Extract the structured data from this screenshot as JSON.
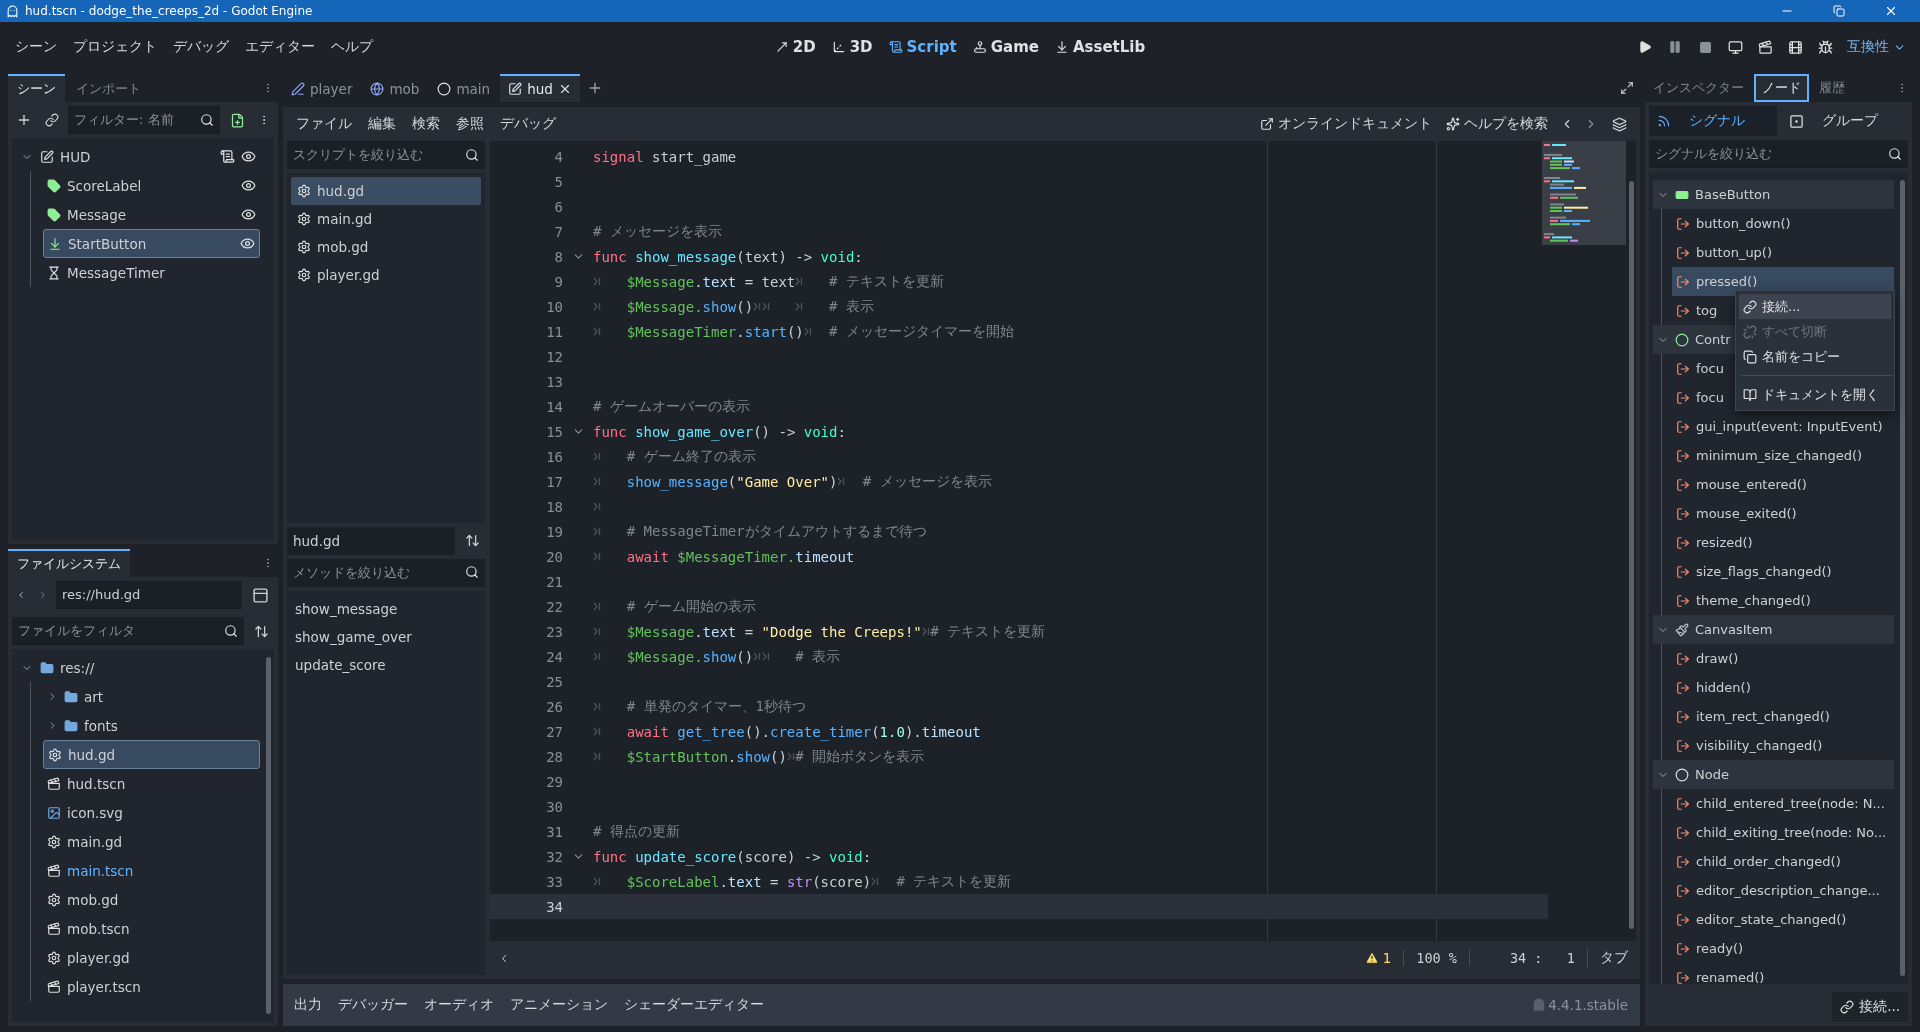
{
  "window": {
    "title": "hud.tscn - dodge_the_creeps_2d - Godot Engine"
  },
  "menu_bar": {
    "menus": [
      "シーン",
      "プロジェクト",
      "デバッグ",
      "エディター",
      "ヘルプ"
    ],
    "workspaces": [
      {
        "label": "2D",
        "kind": "flat",
        "selected": false
      },
      {
        "label": "3D",
        "kind": "spatial",
        "selected": false
      },
      {
        "label": "Script",
        "kind": "script",
        "selected": true
      },
      {
        "label": "Game",
        "kind": "game",
        "selected": false
      },
      {
        "label": "AssetLib",
        "kind": "assetlib",
        "selected": false
      }
    ],
    "renderer": "互換性"
  },
  "scene_dock": {
    "tabs": [
      {
        "label": "シーン",
        "selected": true
      },
      {
        "label": "インポート",
        "selected": false
      }
    ],
    "filter_placeholder": "フィルター: 名前",
    "tree": {
      "name": "HUD",
      "kind": "canvas_layer",
      "expanded": true,
      "script": true,
      "visible_toggle": true,
      "selected": false,
      "children": [
        {
          "name": "ScoreLabel",
          "kind": "label",
          "script": false,
          "visible_toggle": true,
          "selected": false
        },
        {
          "name": "Message",
          "kind": "label",
          "script": false,
          "visible_toggle": true,
          "selected": false
        },
        {
          "name": "StartButton",
          "kind": "button",
          "script": false,
          "visible_toggle": true,
          "selected": true
        },
        {
          "name": "MessageTimer",
          "kind": "timer",
          "script": false,
          "visible_toggle": false,
          "selected": false
        }
      ]
    }
  },
  "filesystem": {
    "tabs": [
      {
        "label": "ファイルシステム",
        "selected": true
      }
    ],
    "path": "res://hud.gd",
    "filter_placeholder": "ファイルをフィルタ",
    "tree": {
      "name": "res://",
      "kind": "folder",
      "expanded": true,
      "children": [
        {
          "name": "art",
          "kind": "folder",
          "expanded": false,
          "selected": false,
          "main_scene": false
        },
        {
          "name": "fonts",
          "kind": "folder",
          "expanded": false,
          "selected": false,
          "main_scene": false
        },
        {
          "name": "hud.gd",
          "kind": "script",
          "selected": true,
          "main_scene": false
        },
        {
          "name": "hud.tscn",
          "kind": "scene",
          "selected": false,
          "main_scene": false
        },
        {
          "name": "icon.svg",
          "kind": "image",
          "selected": false,
          "main_scene": false
        },
        {
          "name": "main.gd",
          "kind": "script",
          "selected": false,
          "main_scene": false
        },
        {
          "name": "main.tscn",
          "kind": "scene",
          "selected": false,
          "main_scene": true
        },
        {
          "name": "mob.gd",
          "kind": "script",
          "selected": false,
          "main_scene": false
        },
        {
          "name": "mob.tscn",
          "kind": "scene",
          "selected": false,
          "main_scene": false
        },
        {
          "name": "player.gd",
          "kind": "script",
          "selected": false,
          "main_scene": false
        },
        {
          "name": "player.tscn",
          "kind": "scene",
          "selected": false,
          "main_scene": false
        }
      ]
    }
  },
  "script_editor": {
    "tabs": [
      {
        "label": "player",
        "kind": "node2d",
        "selected": false
      },
      {
        "label": "mob",
        "kind": "rigid_body",
        "selected": false
      },
      {
        "label": "main",
        "kind": "node",
        "selected": false
      },
      {
        "label": "hud",
        "kind": "canvas_layer",
        "selected": true
      }
    ],
    "menus": [
      "ファイル",
      "編集",
      "検索",
      "参照",
      "デバッグ"
    ],
    "links": [
      {
        "label": "オンラインドキュメント",
        "kind": "external"
      },
      {
        "label": "ヘルプを検索",
        "kind": "help"
      }
    ],
    "script_filter_placeholder": "スクリプトを絞り込む",
    "scripts": [
      {
        "name": "hud.gd",
        "selected": true
      },
      {
        "name": "main.gd",
        "selected": false
      },
      {
        "name": "mob.gd",
        "selected": false
      },
      {
        "name": "player.gd",
        "selected": false
      }
    ],
    "current_script": "hud.gd",
    "method_filter_placeholder": "メソッドを絞り込む",
    "methods": [
      "show_message",
      "show_game_over",
      "update_score"
    ],
    "code": [
      {
        "number": "4",
        "fold": false,
        "current": false,
        "tokens": [
          {
            "kind": "keyword",
            "text": "signal"
          },
          {
            "kind": "text",
            "text": " start_game"
          }
        ]
      },
      {
        "number": "5",
        "fold": false,
        "current": false
      },
      {
        "number": "6",
        "fold": false,
        "current": false
      },
      {
        "number": "7",
        "fold": false,
        "current": false,
        "tokens": [
          {
            "kind": "comment",
            "text": "# メッセージを表示"
          }
        ]
      },
      {
        "number": "8",
        "fold": true,
        "current": false,
        "tokens": [
          {
            "kind": "keyword",
            "text": "func "
          },
          {
            "kind": "function_def",
            "text": "show_message"
          },
          {
            "kind": "text",
            "text": "(text) -> "
          },
          {
            "kind": "type",
            "text": "void"
          },
          {
            "kind": "text",
            "text": ":"
          }
        ]
      },
      {
        "number": "9",
        "fold": false,
        "current": false,
        "tokens": [
          {
            "kind": "tab"
          },
          {
            "kind": "node",
            "text": "$Message"
          },
          {
            "kind": "text",
            "text": "."
          },
          {
            "kind": "member",
            "text": "text"
          },
          {
            "kind": "text",
            "text": " = text"
          },
          {
            "kind": "tab"
          },
          {
            "kind": "comment",
            "text": "# テキストを更新"
          }
        ]
      },
      {
        "number": "10",
        "fold": false,
        "current": false,
        "tokens": [
          {
            "kind": "tab"
          },
          {
            "kind": "node",
            "text": "$Message."
          },
          {
            "kind": "function",
            "text": "show"
          },
          {
            "kind": "text",
            "text": "()"
          },
          {
            "kind": "tab"
          },
          {
            "kind": "tab"
          },
          {
            "kind": "tab"
          },
          {
            "kind": "comment",
            "text": "# 表示"
          }
        ]
      },
      {
        "number": "11",
        "fold": false,
        "current": false,
        "tokens": [
          {
            "kind": "tab"
          },
          {
            "kind": "node",
            "text": "$MessageTimer"
          },
          {
            "kind": "text",
            "text": "."
          },
          {
            "kind": "function",
            "text": "start"
          },
          {
            "kind": "text",
            "text": "()"
          },
          {
            "kind": "tab"
          },
          {
            "kind": "comment",
            "text": "# メッセージタイマーを開始"
          }
        ]
      },
      {
        "number": "12",
        "fold": false,
        "current": false
      },
      {
        "number": "13",
        "fold": false,
        "current": false
      },
      {
        "number": "14",
        "fold": false,
        "current": false,
        "tokens": [
          {
            "kind": "comment",
            "text": "# ゲームオーバーの表示"
          }
        ]
      },
      {
        "number": "15",
        "fold": true,
        "current": false,
        "tokens": [
          {
            "kind": "keyword",
            "text": "func "
          },
          {
            "kind": "function_def",
            "text": "show_game_over"
          },
          {
            "kind": "text",
            "text": "() -> "
          },
          {
            "kind": "type",
            "text": "void"
          },
          {
            "kind": "text",
            "text": ":"
          }
        ]
      },
      {
        "number": "16",
        "fold": false,
        "current": false,
        "tokens": [
          {
            "kind": "tab"
          },
          {
            "kind": "comment",
            "text": "# ゲーム終了の表示"
          }
        ]
      },
      {
        "number": "17",
        "fold": false,
        "current": false,
        "tokens": [
          {
            "kind": "tab"
          },
          {
            "kind": "function",
            "text": "show_message"
          },
          {
            "kind": "text",
            "text": "("
          },
          {
            "kind": "string",
            "text": "\"Game Over\""
          },
          {
            "kind": "text",
            "text": ")"
          },
          {
            "kind": "tab"
          },
          {
            "kind": "comment",
            "text": "# メッセージを表示"
          }
        ]
      },
      {
        "number": "18",
        "fold": false,
        "current": false,
        "tokens": [
          {
            "kind": "tab"
          }
        ]
      },
      {
        "number": "19",
        "fold": false,
        "current": false,
        "tokens": [
          {
            "kind": "tab"
          },
          {
            "kind": "comment",
            "text": "# MessageTimerがタイムアウトするまで待つ"
          }
        ]
      },
      {
        "number": "20",
        "fold": false,
        "current": false,
        "tokens": [
          {
            "kind": "tab"
          },
          {
            "kind": "keyword",
            "text": "await "
          },
          {
            "kind": "node",
            "text": "$MessageTimer."
          },
          {
            "kind": "member",
            "text": "timeout"
          }
        ]
      },
      {
        "number": "21",
        "fold": false,
        "current": false
      },
      {
        "number": "22",
        "fold": false,
        "current": false,
        "tokens": [
          {
            "kind": "tab"
          },
          {
            "kind": "comment",
            "text": "# ゲーム開始の表示"
          }
        ]
      },
      {
        "number": "23",
        "fold": false,
        "current": false,
        "tokens": [
          {
            "kind": "tab"
          },
          {
            "kind": "node",
            "text": "$Message"
          },
          {
            "kind": "text",
            "text": "."
          },
          {
            "kind": "member",
            "text": "text"
          },
          {
            "kind": "text",
            "text": " = "
          },
          {
            "kind": "string",
            "text": "\"Dodge the Creeps!\""
          },
          {
            "kind": "tab"
          },
          {
            "kind": "comment",
            "text": "# テキストを更新"
          }
        ]
      },
      {
        "number": "24",
        "fold": false,
        "current": false,
        "tokens": [
          {
            "kind": "tab"
          },
          {
            "kind": "node",
            "text": "$Message."
          },
          {
            "kind": "function",
            "text": "show"
          },
          {
            "kind": "text",
            "text": "()"
          },
          {
            "kind": "tab"
          },
          {
            "kind": "tab"
          },
          {
            "kind": "comment",
            "text": "# 表示"
          }
        ]
      },
      {
        "number": "25",
        "fold": false,
        "current": false
      },
      {
        "number": "26",
        "fold": false,
        "current": false,
        "tokens": [
          {
            "kind": "tab"
          },
          {
            "kind": "comment",
            "text": "# 単発のタイマー、1秒待つ"
          }
        ]
      },
      {
        "number": "27",
        "fold": false,
        "current": false,
        "tokens": [
          {
            "kind": "tab"
          },
          {
            "kind": "keyword",
            "text": "await "
          },
          {
            "kind": "function",
            "text": "get_tree"
          },
          {
            "kind": "text",
            "text": "()."
          },
          {
            "kind": "function",
            "text": "create_timer"
          },
          {
            "kind": "text",
            "text": "("
          },
          {
            "kind": "number",
            "text": "1.0"
          },
          {
            "kind": "text",
            "text": ")."
          },
          {
            "kind": "member",
            "text": "timeout"
          }
        ]
      },
      {
        "number": "28",
        "fold": false,
        "current": false,
        "tokens": [
          {
            "kind": "tab"
          },
          {
            "kind": "node",
            "text": "$StartButton"
          },
          {
            "kind": "text",
            "text": "."
          },
          {
            "kind": "function",
            "text": "show"
          },
          {
            "kind": "text",
            "text": "()"
          },
          {
            "kind": "tab"
          },
          {
            "kind": "comment",
            "text": "# 開始ボタンを表示"
          }
        ]
      },
      {
        "number": "29",
        "fold": false,
        "current": false
      },
      {
        "number": "30",
        "fold": false,
        "current": false
      },
      {
        "number": "31",
        "fold": false,
        "current": false,
        "tokens": [
          {
            "kind": "comment",
            "text": "# 得点の更新"
          }
        ]
      },
      {
        "number": "32",
        "fold": true,
        "current": false,
        "tokens": [
          {
            "kind": "keyword",
            "text": "func "
          },
          {
            "kind": "function_def",
            "text": "update_score"
          },
          {
            "kind": "text",
            "text": "(score) -> "
          },
          {
            "kind": "type",
            "text": "void"
          },
          {
            "kind": "text",
            "text": ":"
          }
        ]
      },
      {
        "number": "33",
        "fold": false,
        "current": false,
        "tokens": [
          {
            "kind": "tab"
          },
          {
            "kind": "node",
            "text": "$ScoreLabel"
          },
          {
            "kind": "text",
            "text": "."
          },
          {
            "kind": "member",
            "text": "text"
          },
          {
            "kind": "text",
            "text": " = "
          },
          {
            "kind": "builtin",
            "text": "str"
          },
          {
            "kind": "text",
            "text": "(score)"
          },
          {
            "kind": "tab"
          },
          {
            "kind": "comment",
            "text": "# テキストを更新"
          }
        ]
      },
      {
        "number": "34",
        "fold": false,
        "current": true
      }
    ],
    "status": {
      "warnings": "1",
      "zoom": "100 %",
      "cursor": "34 :   1",
      "indent": "タブ"
    }
  },
  "bottom_panel": {
    "tabs": [
      "出力",
      "デバッガー",
      "オーディオ",
      "アニメーション",
      "シェーダーエディター"
    ],
    "version": "4.4.1.stable"
  },
  "node_dock": {
    "tabs": [
      {
        "label": "インスペクター",
        "selected": false
      },
      {
        "label": "ノード",
        "selected": true
      },
      {
        "label": "履歴",
        "selected": false
      }
    ],
    "subtabs": [
      {
        "label": "シグナル",
        "kind": "signals",
        "selected": true
      },
      {
        "label": "グループ",
        "kind": "groups",
        "selected": false
      }
    ],
    "filter_placeholder": "シグナルを絞り込む",
    "groups": [
      {
        "name": "BaseButton",
        "kind": "button",
        "signals": [
          {
            "name": "button_down()",
            "selected": false
          },
          {
            "name": "button_up()",
            "selected": false
          },
          {
            "name": "pressed()",
            "selected": true
          },
          {
            "name": "tog",
            "selected": false
          }
        ]
      },
      {
        "name": "Contr",
        "kind": "control",
        "signals": [
          {
            "name": "focu",
            "selected": false
          },
          {
            "name": "focu",
            "selected": false
          },
          {
            "name": "gui_input(event: InputEvent)",
            "selected": false
          },
          {
            "name": "minimum_size_changed()",
            "selected": false
          },
          {
            "name": "mouse_entered()",
            "selected": false
          },
          {
            "name": "mouse_exited()",
            "selected": false
          },
          {
            "name": "resized()",
            "selected": false
          },
          {
            "name": "size_flags_changed()",
            "selected": false
          },
          {
            "name": "theme_changed()",
            "selected": false
          }
        ]
      },
      {
        "name": "CanvasItem",
        "kind": "canvas_item",
        "signals": [
          {
            "name": "draw()",
            "selected": false
          },
          {
            "name": "hidden()",
            "selected": false
          },
          {
            "name": "item_rect_changed()",
            "selected": false
          },
          {
            "name": "visibility_changed()",
            "selected": false
          }
        ]
      },
      {
        "name": "Node",
        "kind": "node",
        "signals": [
          {
            "name": "child_entered_tree(node: N...",
            "selected": false
          },
          {
            "name": "child_exiting_tree(node: No...",
            "selected": false
          },
          {
            "name": "child_order_changed()",
            "selected": false
          },
          {
            "name": "editor_description_change...",
            "selected": false
          },
          {
            "name": "editor_state_changed()",
            "selected": false
          },
          {
            "name": "ready()",
            "selected": false
          },
          {
            "name": "renamed()",
            "selected": false
          }
        ]
      }
    ],
    "context_menu": [
      {
        "label": "接続...",
        "kind": "connect",
        "disabled": false,
        "hovered": true
      },
      {
        "label": "すべて切断",
        "kind": "disconnect",
        "disabled": true,
        "hovered": false
      },
      {
        "label": "名前をコピー",
        "kind": "copy",
        "disabled": false,
        "hovered": false
      },
      {
        "kind": "separator"
      },
      {
        "label": "ドキュメントを開く",
        "kind": "docs",
        "disabled": false,
        "hovered": false
      }
    ],
    "connect_button": "接続..."
  }
}
